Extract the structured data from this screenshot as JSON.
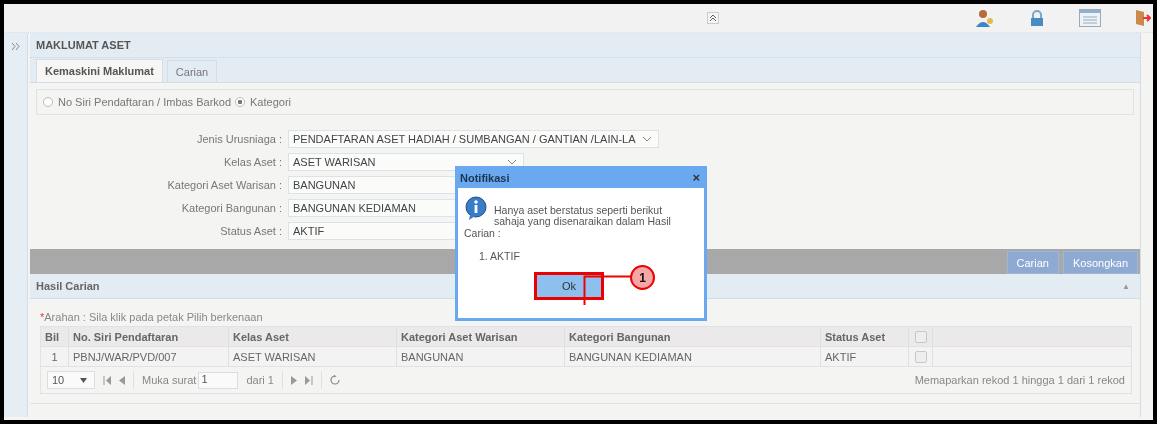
{
  "panel": {
    "title": "MAKLUMAT ASET"
  },
  "tabs": [
    {
      "label": "Kemaskini Maklumat",
      "selected": true
    },
    {
      "label": "Carian",
      "selected": false
    }
  ],
  "search_mode": [
    {
      "label": "No Siri Pendaftaran / Imbas Barkod",
      "selected": false
    },
    {
      "label": "Kategori",
      "selected": true
    }
  ],
  "form": [
    {
      "label": "Jenis Urusniaga :",
      "value": "PENDAFTARAN ASET HADIAH / SUMBANGAN / GANTIAN /LAIN-LA",
      "kind": "select"
    },
    {
      "label": "Kelas Aset :",
      "value": "ASET WARISAN",
      "kind": "select"
    },
    {
      "label": "Kategori Aset Warisan :",
      "value": "BANGUNAN",
      "kind": "input"
    },
    {
      "label": "Kategori Bangunan :",
      "value": "BANGUNAN KEDIAMAN",
      "kind": "input"
    },
    {
      "label": "Status Aset :",
      "value": "AKTIF",
      "kind": "input"
    }
  ],
  "actions": [
    "Carian",
    "Kosongkan"
  ],
  "results": {
    "title": "Hasil Carian",
    "collapse": "▲",
    "note_mark": "*",
    "note": "Arahan : Sila klik pada petak Pilih berkenaan",
    "columns": [
      "Bil",
      "No. Siri Pendaftaran",
      "Kelas Aset",
      "Kategori Aset Warisan",
      "Kategori Bangunan",
      "Status Aset"
    ],
    "select_all": {
      "checked": false
    },
    "rows": [
      {
        "cells": [
          "1",
          "PBNJ/WAR/PVD/007",
          "ASET WARISAN",
          "BANGUNAN",
          "BANGUNAN KEDIAMAN",
          "AKTIF"
        ],
        "checked": false
      }
    ],
    "pager": {
      "page_size": "10",
      "page_label": "Muka surat",
      "page": "1",
      "of": "dari 1",
      "summary": "Memaparkan rekod 1 hingga 1 dari 1 rekod"
    }
  },
  "dialog": {
    "title": "Notifikasi",
    "close": "×",
    "message": "Hanya aset berstatus seperti berikut sahaja yang disenaraikan dalam Hasil",
    "message_end": "Carian :",
    "items": [
      "1. AKTIF"
    ],
    "button": "Ok",
    "callout": "1"
  }
}
